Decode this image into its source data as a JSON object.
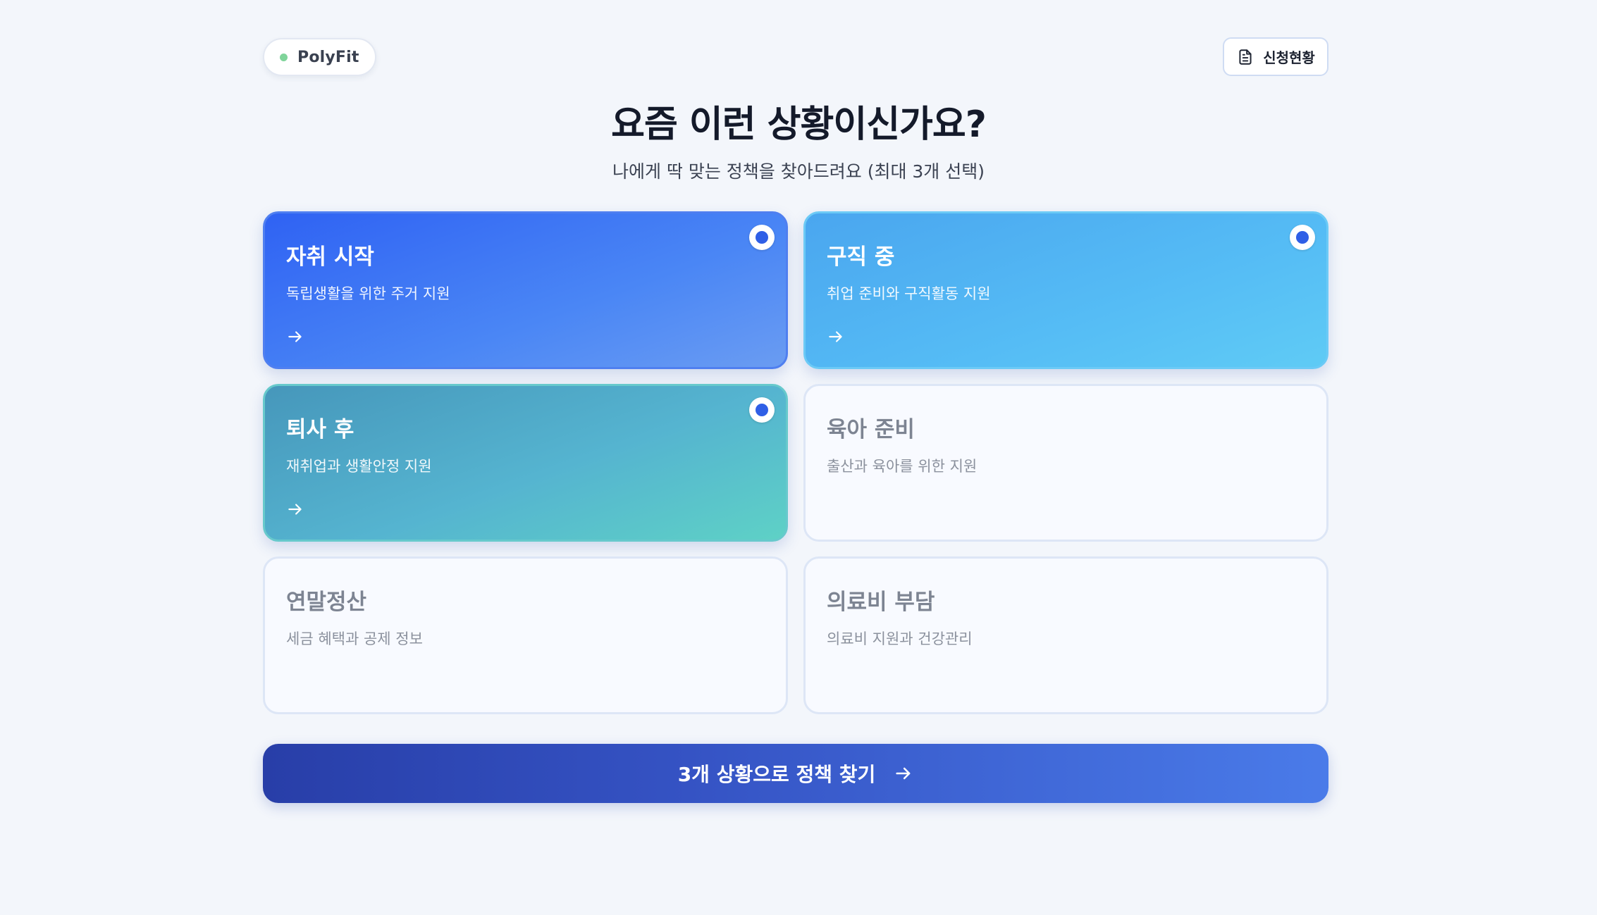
{
  "header": {
    "brand": "PolyFit",
    "status_button": "신청현황",
    "title": "요즘 이런 상황이신가요?",
    "subtitle": "나에게 딱 맞는 정책을 찾아드려요 (최대 3개 선택)"
  },
  "cards": [
    {
      "title": "자취 시작",
      "description": "독립생활을 위한 주거 지원",
      "selected": true
    },
    {
      "title": "구직 중",
      "description": "취업 준비와 구직활동 지원",
      "selected": true
    },
    {
      "title": "퇴사 후",
      "description": "재취업과 생활안정 지원",
      "selected": true
    },
    {
      "title": "육아 준비",
      "description": "출산과 육아를 위한 지원",
      "selected": false
    },
    {
      "title": "연말정산",
      "description": "세금 혜택과 공제 정보",
      "selected": false
    },
    {
      "title": "의료비 부담",
      "description": "의료비 지원과 건강관리",
      "selected": false
    }
  ],
  "action": {
    "label": "3개 상황으로 정책 찾기"
  },
  "colors": {
    "accent": "#2f5fe6",
    "background": "#f3f6fb",
    "brand_dot": "#7fd49a"
  },
  "icons": {
    "status": "document-icon",
    "card_arrow": "arrow-right-icon",
    "button_arrow": "arrow-right-icon"
  }
}
